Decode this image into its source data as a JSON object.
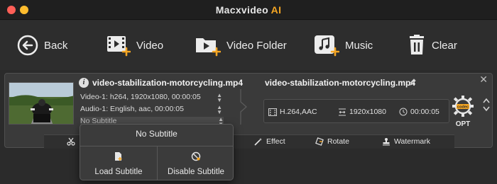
{
  "window": {
    "title_main": "Macxvideo",
    "title_accent": "AI",
    "accent_color": "#f5a623"
  },
  "toolbar": {
    "back_label": "Back",
    "video_label": "Video",
    "video_folder_label": "Video Folder",
    "music_label": "Music",
    "clear_label": "Clear"
  },
  "item": {
    "source_name": "video-stabilization-motorcycling.mp4",
    "video_track": "Video-1: h264, 1920x1080, 00:00:05",
    "audio_track": "Audio-1: English, aac, 00:00:05",
    "subtitle_track": "No Subtitle",
    "output_name": "video-stabilization-motorcycling.mp4",
    "output_codec": "H.264,AAC",
    "output_resolution": "1920x1080",
    "output_duration": "00:00:05",
    "opt_label": "OPT",
    "opt_badge": "codec"
  },
  "actions": {
    "effect_label": "Effect",
    "rotate_label": "Rotate",
    "watermark_label": "Watermark"
  },
  "subtitle_popup": {
    "title": "No Subtitle",
    "load_label": "Load Subtitle",
    "disable_label": "Disable Subtitle"
  },
  "icons": {
    "back": "back-arrow-circle-icon",
    "video": "film-plus-icon",
    "video_folder": "folder-play-icon",
    "music": "music-note-icon",
    "clear": "trash-icon",
    "info": "info-icon",
    "pencil": "pencil-icon",
    "opt": "gear-icon"
  }
}
